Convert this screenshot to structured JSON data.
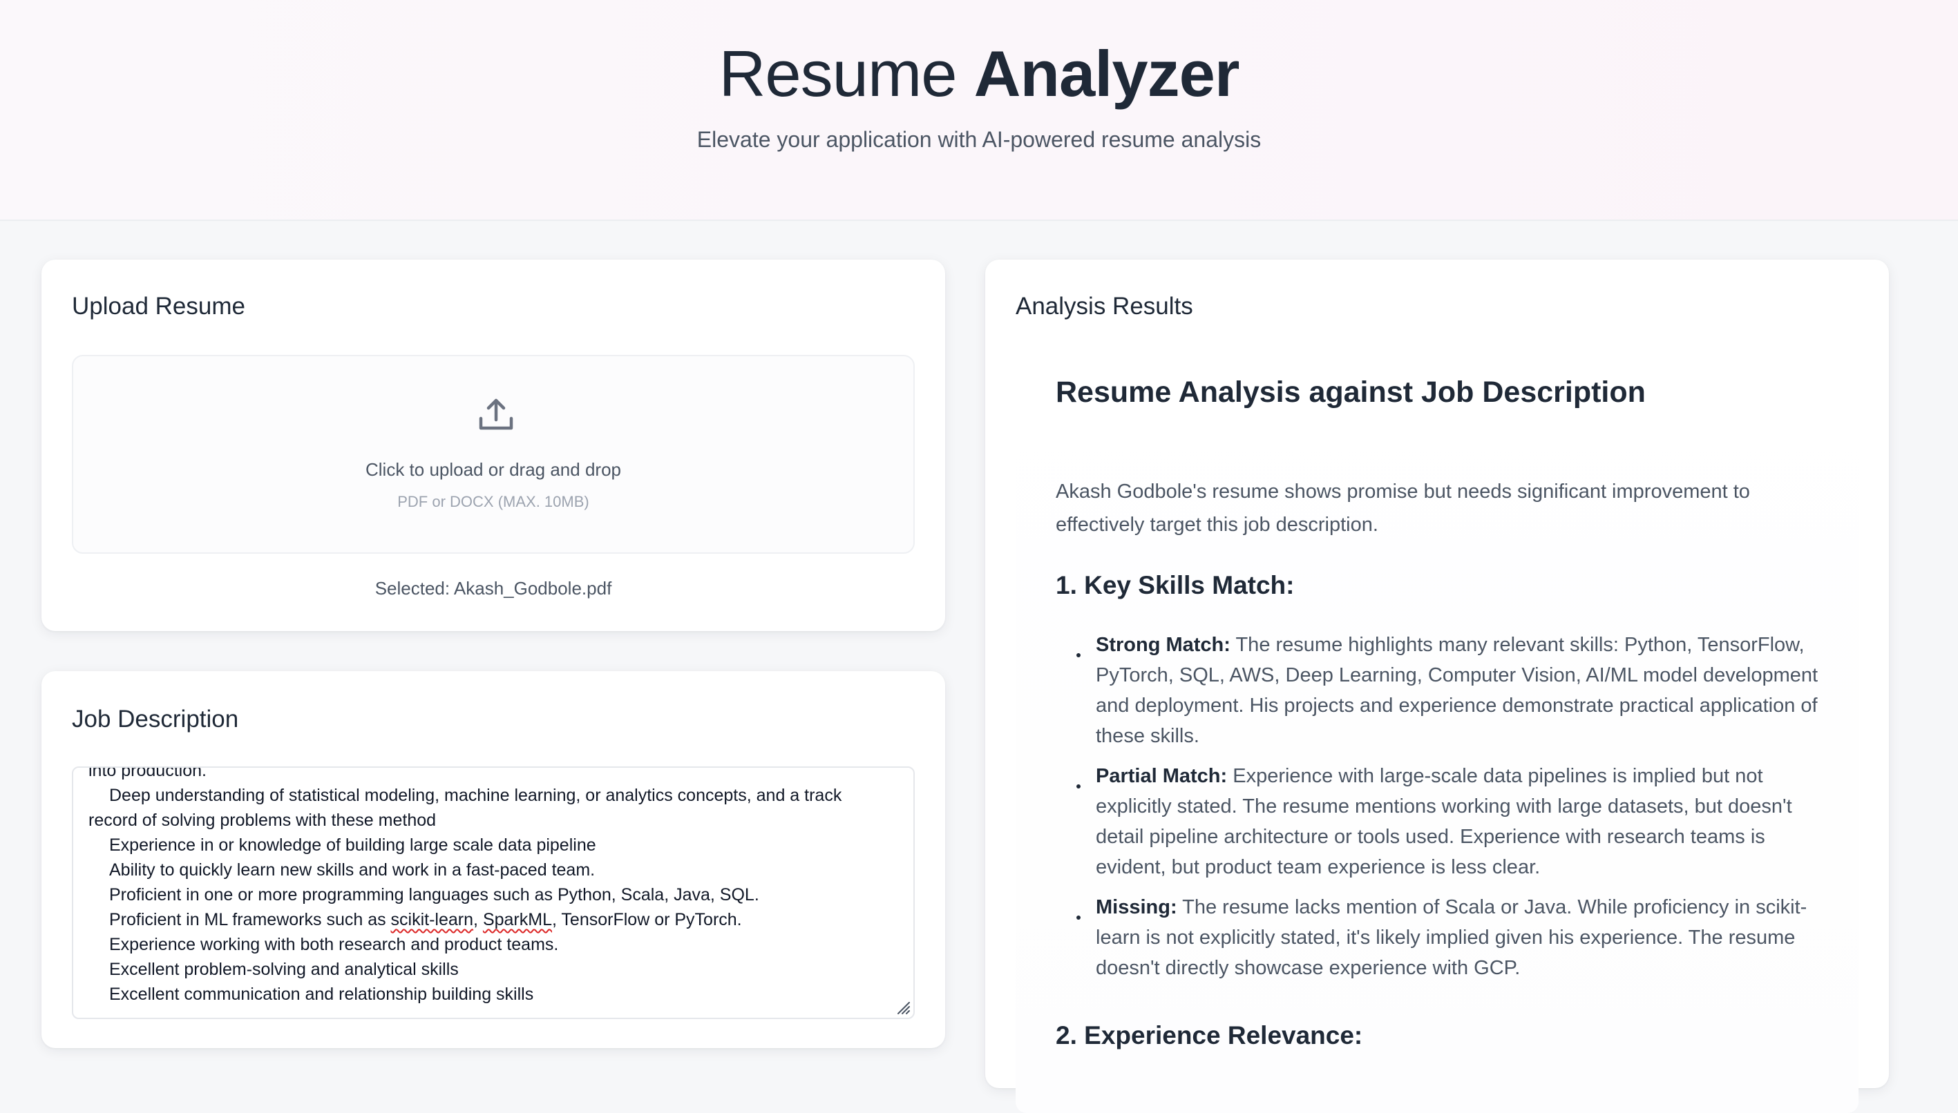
{
  "header": {
    "title_regular": "Resume",
    "title_bold": "Analyzer",
    "subtitle": "Elevate your application with AI-powered resume analysis"
  },
  "upload": {
    "heading": "Upload Resume",
    "icon": "upload-icon",
    "drop_text": "Click to upload or drag and drop",
    "drop_hint": "PDF or DOCX (MAX. 10MB)",
    "selected": "Selected: Akash_Godbole.pdf"
  },
  "job_description": {
    "heading": "Job Description",
    "lines": [
      "into production.",
      "Deep understanding of statistical modeling, machine learning, or analytics concepts, and a track",
      "record of solving problems with these method",
      "Experience in or knowledge of building large scale data pipeline",
      "Ability to quickly learn new skills and work in a fast-paced team.",
      "Proficient in one or more programming languages such as Python, Scala, Java, SQL.",
      "Proficient in ML frameworks such as ",
      "scikit-learn",
      ", ",
      "SparkML",
      ", TensorFlow or PyTorch.",
      "Experience working with both research and product teams.",
      "Excellent problem-solving and analytical skills",
      "Excellent communication and relationship building skills"
    ]
  },
  "results": {
    "heading": "Analysis Results",
    "title": "Resume Analysis against Job Description",
    "intro": "Akash Godbole's resume shows promise but needs significant improvement to effectively target this job description.",
    "section1": "1. Key Skills Match:",
    "bullets": [
      {
        "label": "Strong Match:",
        "text": " The resume highlights many relevant skills: Python, TensorFlow, PyTorch, SQL, AWS, Deep Learning, Computer Vision, AI/ML model development and deployment. His projects and experience demonstrate practical application of these skills."
      },
      {
        "label": "Partial Match:",
        "text": " Experience with large-scale data pipelines is implied but not explicitly stated. The resume mentions working with large datasets, but doesn't detail pipeline architecture or tools used. Experience with research teams is evident, but product team experience is less clear."
      },
      {
        "label": "Missing:",
        "text": " The resume lacks mention of Scala or Java. While proficiency in scikit-learn is not explicitly stated, it's likely implied given his experience. The resume doesn't directly showcase experience with GCP."
      }
    ],
    "section2": "2. Experience Relevance:"
  }
}
